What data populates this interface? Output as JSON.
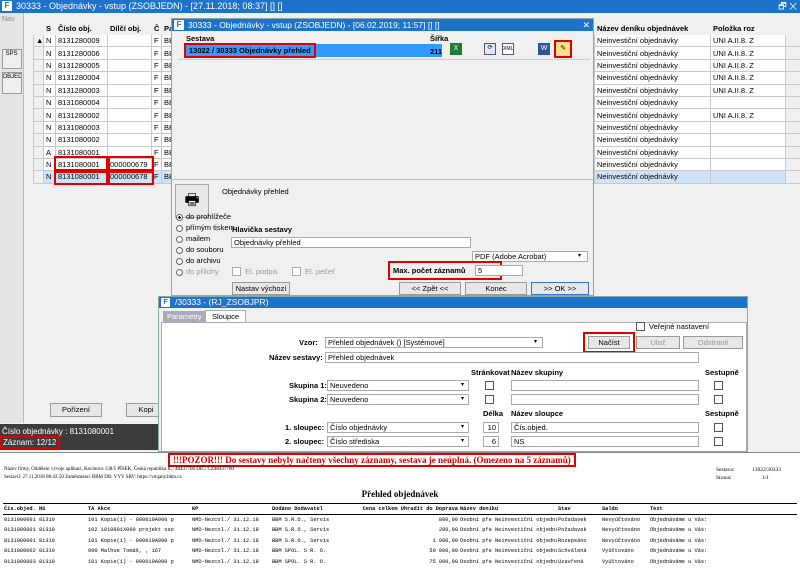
{
  "main_window": {
    "title": "30333 - Objednávky - vstup (ZSOBJEDN) - [27.11.2018; 08:37] [] []",
    "restore": "🗗 ✕"
  },
  "sidebar": {
    "nav_label": "Nav",
    "items": [
      {
        "label": "SPS"
      },
      {
        "label": "OBJEDNÁVKY"
      }
    ]
  },
  "grid": {
    "columns": [
      "S",
      "Číslo obj.",
      "Dílčí obj.",
      "Č",
      "Partn"
    ],
    "rows": [
      [
        "N",
        "8131280009",
        "",
        "F",
        "BBM"
      ],
      [
        "N",
        "8131280006",
        "",
        "F",
        "BBM"
      ],
      [
        "N",
        "8131280005",
        "",
        "F",
        "BBM"
      ],
      [
        "N",
        "8131280004",
        "",
        "F",
        "BBM"
      ],
      [
        "N",
        "8131280003",
        "",
        "F",
        "BBM"
      ],
      [
        "N",
        "8131080004",
        "",
        "F",
        "BBM"
      ],
      [
        "N",
        "8131280002",
        "",
        "F",
        "BBM"
      ],
      [
        "N",
        "8131080003",
        "",
        "F",
        "BBM"
      ],
      [
        "N",
        "8131080002",
        "",
        "F",
        "BBM"
      ],
      [
        "A",
        "8131080001",
        "",
        "F",
        "BBM"
      ],
      [
        "N",
        "8131080001",
        "000000679",
        "F",
        "BBM"
      ],
      [
        "N",
        "8131080001",
        "000000678",
        "F",
        "BBM"
      ]
    ],
    "right_columns": [
      "Název deníku objednávek",
      "Položka roz"
    ],
    "right_rows": [
      [
        "Neinvestiční objednávky",
        "UNI A.II.8. Z"
      ],
      [
        "Neinvestiční objednávky",
        "UNI A.II.8. Z"
      ],
      [
        "Neinvestiční objednávky",
        "UNI A.II.8. Z"
      ],
      [
        "Neinvestiční objednávky",
        "UNI A.II.8. Z"
      ],
      [
        "Neinvestiční objednávky",
        "UNI A.II.8. Z"
      ],
      [
        "Neinvestiční objednávky",
        ""
      ],
      [
        "Neinvestiční objednávky",
        "UNI A.II.8. Z"
      ],
      [
        "Neinvestiční objednávky",
        ""
      ],
      [
        "Neinvestiční objednávky",
        ""
      ],
      [
        "Neinvestiční objednávky",
        ""
      ],
      [
        "Neinvestiční objednávky",
        ""
      ],
      [
        "Neinvestiční objednávky",
        ""
      ]
    ]
  },
  "bottom_left": {
    "button_porizeni": "Pořízení",
    "button_kopie": "Kopi",
    "status_obj": "Číslo objednávky : 8131080001",
    "status_count": "Záznam: 12/12"
  },
  "print_dialog": {
    "title": "30333 - Objednávky - vstup (ZSOBJEDN) - [06.02.2019; 11:57] [] []",
    "col_sestava": "Sestava",
    "col_sirka": "Šířka",
    "row_name": "13022 / 30333  Objednávky přehled",
    "row_width": "211",
    "preview_title": "Objednávky přehled",
    "options": [
      "do prohlížeče",
      "přímým tiskem",
      "mailem",
      "do souboru",
      "do archivu",
      "do přílohy"
    ],
    "header_label": "Hlavička sestavy",
    "header_value": "Objednávky přehled",
    "format_value": "PDF (Adobe Acrobat)",
    "el_podpis": "El. podpis",
    "el_pecet": "El. pečeť",
    "max_label": "Max. počet záznamů",
    "max_value": "5",
    "btn_default": "Nastav výchozí",
    "btn_back": "<< Zpět <<",
    "btn_end": "Konec",
    "btn_ok": ">> OK >>"
  },
  "rj_dialog": {
    "title": "/30333 - (RJ_ZSOBJPR)",
    "tabs": [
      "Parametry",
      "Sloupce"
    ],
    "vzor_label": "Vzor:",
    "vzor_value": "Přehled objednávek  ()  [Systémové]",
    "public_label": "Veřejné nastavení",
    "btn_nacist": "Načíst",
    "btn_ulozit": "Ulož",
    "btn_odstranit": "Odstranit",
    "nazev_label": "Název sestavy:",
    "nazev_value": "Přehled objednávek",
    "h_strankovat": "Stránkovat",
    "h_nazev_skupiny": "Název skupiny",
    "h_sestupne": "Sestupně",
    "skupina1_label": "Skupina 1:",
    "skupina1_value": "Neuvedeno",
    "skupina2_label": "Skupina 2:",
    "skupina2_value": "Neuvedeno",
    "h_delka": "Délka",
    "h_nazev_sloupce": "Název sloupce",
    "h_sestupne2": "Sestupně",
    "s1_label": "1. sloupec:",
    "s1_value": "Číslo objednávky",
    "s1_len": "10",
    "s1_name": "Čís.objed.",
    "s2_label": "2. sloupec:",
    "s2_value": "Číslo střediska",
    "s2_len": "6",
    "s2_name": "NS"
  },
  "report": {
    "warning": "!!!POZOR!!! Do sestavy nebyly načteny všechny záznamy, sestava je neúplná. (Omezeno na 5 záznamů)",
    "hdr_line1": "Název firmy, Oddělení vývoje aplikací, Kocinova 138/5 PÍSEK, Česká republika IČ: 48437700 DIČ: CZ48437700",
    "hdr_line2": "Sestavil: 27.11.2018 08:43:50 Zaměstnanci BBM  DB: VYV  SRV: https://vmjany.bbm.cz",
    "sestava_label": "Sestava:",
    "sestava_value": "13022/30333",
    "strana_label": "Strana:",
    "strana_value": "1/1",
    "title": "Přehled objednávek",
    "columns": [
      "Čís.objed. NS",
      "TA Akce",
      "KP",
      "Dodáno Dodavatel",
      "Cena celkem Uhradit do Doprava",
      "Název deníku",
      "Stav",
      "Saldo",
      "Text"
    ],
    "rows": [
      [
        "8131080001 81310",
        "101 Kopie(1) - 000010A000 p",
        "NMD-Nezcol./ 31.12.18",
        "BBM S.R.O., Servis",
        "800,00",
        "Osobní pře Neinvestiční objednávky",
        "Požadavek",
        "Nevyúčtováno",
        "Objednáváme u Vás:"
      ],
      [
        "8131080001 81310",
        "102 1010801X000 projekt oso",
        "NMD-Nezcol./ 31.12.18",
        "BBM S.R.O., Servis",
        "200,00",
        "Osobní pře Neinvestiční objednávky",
        "Požadavek",
        "Nevyúčtováno",
        "Objednáváme u Vás:"
      ],
      [
        "8131080001 81310",
        "101 Kopie(1) - 000010A000 p",
        "NMD-Nezcol./ 31.12.18",
        "BBM S.R.O., Servis",
        "1 000,00",
        "Osobní pře Neinvestiční objednávky",
        "Rozepsáno",
        "Nevyúčtováno",
        "Objednáváme u Vás:"
      ],
      [
        "8131080002 81310",
        "090 Malhue Tomáš, , 167",
        "NMD-Nezcol./ 31.12.18",
        "BBM SPOL. S R. O.",
        "50 000,00",
        "Osobní pře Neinvestiční objednávky",
        "Schválená",
        "Vyúčtováno",
        "Objednáváme u Vás:"
      ],
      [
        "8131080003 81310",
        "101 Kopie(1) - 000010A000 p",
        "NMD-Nezcol./ 31.12.18",
        "BBM SPOL. S R. O.",
        "75 000,00",
        "Osobní pře Neinvestiční objednávky",
        "Uzavřená",
        "Vyúčtováno",
        "Objednáváme u Vás:"
      ]
    ]
  },
  "colors": {
    "titlebar": "#1d73c9",
    "highlight": "#e00000",
    "selection": "#cfe3f8"
  }
}
